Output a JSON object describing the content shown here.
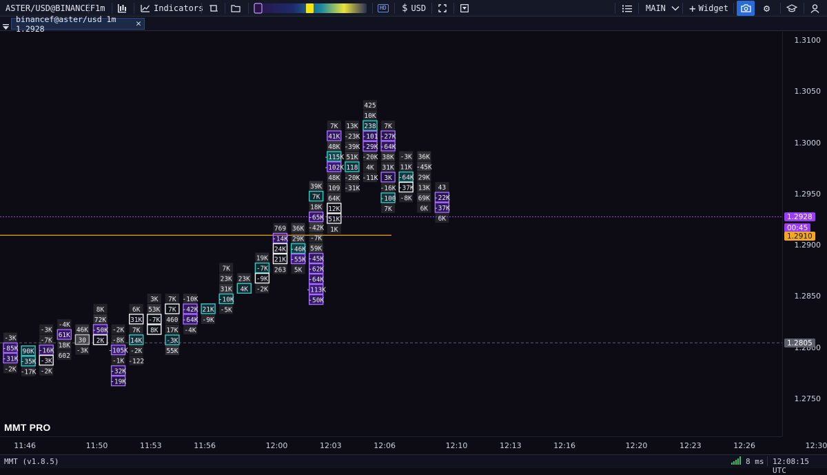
{
  "toolbar": {
    "symbol": "ASTER/USD@BINANCEF",
    "interval": "1m",
    "indicators_label": "Indicators",
    "hd_label": "HD",
    "currency_label": "USD",
    "layout_label": "MAIN",
    "widget_label": "Widget"
  },
  "tab": {
    "label": "binancef@aster/usd 1m 1.2928"
  },
  "chart": {
    "watermark": "MMT PRO",
    "y_ticks": [
      "1.3100",
      "1.3050",
      "1.3000",
      "1.2950",
      "1.2900",
      "1.2850",
      "1.2800",
      "1.2750"
    ],
    "x_ticks": [
      "11:46",
      "11:50",
      "11:53",
      "11:56",
      "12:00",
      "12:03",
      "12:06",
      "12:10",
      "12:13",
      "12:16",
      "12:20",
      "12:23",
      "12:26",
      "12:30"
    ],
    "price_tags": {
      "last_price": "1.2928",
      "countdown": "00:45",
      "orange_level": "1.2910",
      "grey_level": "1.2805"
    },
    "colors": {
      "background": "#0d0c14",
      "last_price": "#9a3df5",
      "orange_level": "#f0a825",
      "grey_level": "#5c5f6b",
      "teal": "#37c8c0"
    },
    "columns": [
      {
        "time": "11:45",
        "cells": [
          [
            "-3K",
            0.35,
            "d"
          ],
          [
            "-85K",
            0.6,
            "p"
          ],
          [
            "-31K",
            0.5,
            "p"
          ],
          [
            "-2K",
            0.3,
            "d"
          ]
        ]
      },
      {
        "time": "11:46",
        "cells": [
          [
            "90K",
            0.5,
            "t"
          ],
          [
            "-35K",
            0.55,
            "t"
          ],
          [
            "-17K",
            0.3,
            "d"
          ]
        ]
      },
      {
        "time": "11:47",
        "cells": [
          [
            "-3K",
            0.3,
            "d"
          ],
          [
            "-7K",
            0.35,
            "d"
          ],
          [
            "-16K",
            0.5,
            "p"
          ],
          [
            "-3K",
            0.4,
            "w"
          ],
          [
            "-2K",
            0.3,
            "d"
          ]
        ]
      },
      {
        "time": "11:48",
        "cells": [
          [
            "-4K",
            0.3,
            "d"
          ],
          [
            "61K",
            0.6,
            "p"
          ],
          [
            "18K",
            0.4,
            "d"
          ],
          [
            "602",
            0.3,
            "d"
          ]
        ]
      },
      {
        "time": "11:49",
        "cells": [
          [
            "46K",
            0.5,
            "d"
          ],
          [
            "30",
            0.6,
            "g"
          ],
          [
            "-3K",
            0.3,
            "d"
          ]
        ]
      },
      {
        "time": "11:50",
        "cells": [
          [
            "8K",
            0.3,
            "d"
          ],
          [
            "72K",
            0.5,
            "d"
          ],
          [
            "-50K",
            0.6,
            "p"
          ],
          [
            "2K",
            0.5,
            "w"
          ]
        ]
      },
      {
        "time": "11:51",
        "cells": [
          [
            "-2K",
            0.3,
            "d"
          ],
          [
            "-8K",
            0.35,
            "d"
          ],
          [
            "-105K",
            0.7,
            "p"
          ],
          [
            "-1K",
            0.3,
            "d"
          ],
          [
            "-32K",
            0.45,
            "p"
          ],
          [
            "-19K",
            0.35,
            "p"
          ]
        ]
      },
      {
        "time": "11:52",
        "cells": [
          [
            "6K",
            0.3,
            "d"
          ],
          [
            "31K",
            0.5,
            "w"
          ],
          [
            "7K",
            0.35,
            "d"
          ],
          [
            "14K",
            0.45,
            "t"
          ],
          [
            "-2K",
            0.3,
            "d"
          ],
          [
            "-122",
            0.3,
            "d"
          ]
        ]
      },
      {
        "time": "11:53",
        "cells": [
          [
            "3K",
            0.3,
            "d"
          ],
          [
            "53K",
            0.5,
            "d"
          ],
          [
            "-7K",
            0.35,
            "w"
          ],
          [
            "8K",
            0.35,
            "w"
          ]
        ]
      },
      {
        "time": "11:54",
        "cells": [
          [
            "7K",
            0.3,
            "d"
          ],
          [
            "7K",
            0.35,
            "w"
          ],
          [
            "460",
            0.3,
            "d"
          ],
          [
            "17K",
            0.35,
            "d"
          ],
          [
            "-3K",
            0.35,
            "t"
          ],
          [
            "55K",
            0.5,
            "d"
          ]
        ]
      },
      {
        "time": "11:55",
        "cells": [
          [
            "-10K",
            0.35,
            "d"
          ],
          [
            "-42K",
            0.55,
            "p"
          ],
          [
            "-64K",
            0.6,
            "p"
          ],
          [
            "-4K",
            0.3,
            "d"
          ]
        ]
      },
      {
        "time": "11:56",
        "cells": [
          [
            "21K",
            0.45,
            "t"
          ],
          [
            "-9K",
            0.35,
            "d"
          ]
        ]
      },
      {
        "time": "11:57",
        "cells": [
          [
            "7K",
            0.3,
            "d"
          ],
          [
            "23K",
            0.4,
            "d"
          ],
          [
            "31K",
            0.5,
            "d"
          ],
          [
            "-10K",
            0.4,
            "t"
          ],
          [
            "-5K",
            0.3,
            "d"
          ]
        ]
      },
      {
        "time": "11:58",
        "cells": [
          [
            "23K",
            0.4,
            "d"
          ],
          [
            "4K",
            0.35,
            "t"
          ]
        ]
      },
      {
        "time": "11:59",
        "cells": [
          [
            "19K",
            0.35,
            "d"
          ],
          [
            "-7K",
            0.35,
            "t"
          ],
          [
            "-9K",
            0.4,
            "w"
          ],
          [
            "-2K",
            0.3,
            "d"
          ]
        ]
      },
      {
        "time": "12:00",
        "cells": [
          [
            "769",
            0.3,
            "d"
          ],
          [
            "-14K",
            0.5,
            "p"
          ],
          [
            "24K",
            0.5,
            "w"
          ],
          [
            "21K",
            0.5,
            "w"
          ],
          [
            "263",
            0.3,
            "d"
          ]
        ]
      },
      {
        "time": "12:01",
        "cells": [
          [
            "36K",
            0.5,
            "d"
          ],
          [
            "29K",
            0.45,
            "d"
          ],
          [
            "-46K",
            0.6,
            "t"
          ],
          [
            "-55K",
            0.7,
            "p"
          ],
          [
            "5K",
            0.3,
            "d"
          ]
        ]
      },
      {
        "time": "12:02",
        "cells": [
          [
            "39K",
            0.5,
            "d"
          ],
          [
            "7K",
            0.35,
            "t"
          ],
          [
            "18K",
            0.4,
            "d"
          ],
          [
            "-65K",
            0.6,
            "p"
          ],
          [
            "-42K",
            0.55,
            "d"
          ],
          [
            "-7K",
            0.35,
            "d"
          ],
          [
            "59K",
            0.5,
            "d"
          ],
          [
            "-45K",
            0.55,
            "p"
          ],
          [
            "-62K",
            0.6,
            "p"
          ],
          [
            "-64K",
            0.6,
            "p"
          ],
          [
            "-113K",
            0.75,
            "p"
          ],
          [
            "-50K",
            0.55,
            "p"
          ]
        ]
      },
      {
        "time": "12:03",
        "cells": [
          [
            "7K",
            0.3,
            "d"
          ],
          [
            "41K",
            0.55,
            "p"
          ],
          [
            "48K",
            0.55,
            "d"
          ],
          [
            "-115K",
            0.75,
            "t"
          ],
          [
            "-102K",
            0.7,
            "p"
          ],
          [
            "48K",
            0.5,
            "d"
          ],
          [
            "109",
            0.45,
            "d"
          ],
          [
            "64K",
            0.5,
            "d"
          ],
          [
            "12K",
            0.4,
            "w"
          ],
          [
            "51K",
            0.5,
            "w"
          ],
          [
            "1K",
            0.3,
            "d"
          ]
        ]
      },
      {
        "time": "12:04",
        "cells": [
          [
            "13K",
            0.35,
            "d"
          ],
          [
            "-23K",
            0.4,
            "d"
          ],
          [
            "-39K",
            0.45,
            "d"
          ],
          [
            "51K",
            0.5,
            "d"
          ],
          [
            "118",
            0.5,
            "t"
          ],
          [
            "-20K",
            0.4,
            "d"
          ],
          [
            "-31K",
            0.4,
            "d"
          ]
        ]
      },
      {
        "time": "12:05",
        "cells": [
          [
            "425",
            0.3,
            "d"
          ],
          [
            "10K",
            0.35,
            "d"
          ],
          [
            "238",
            0.5,
            "t"
          ],
          [
            "-101",
            0.5,
            "p"
          ],
          [
            "-29K",
            0.45,
            "p"
          ],
          [
            "-20K",
            0.4,
            "d"
          ],
          [
            "4K",
            0.3,
            "d"
          ],
          [
            "-11K",
            0.35,
            "d"
          ]
        ]
      },
      {
        "time": "12:06",
        "cells": [
          [
            "7K",
            0.3,
            "d"
          ],
          [
            "-27K",
            0.45,
            "p"
          ],
          [
            "-64K",
            0.55,
            "p"
          ],
          [
            "38K",
            0.45,
            "d"
          ],
          [
            "31K",
            0.4,
            "d"
          ],
          [
            "3K",
            0.3,
            "p"
          ],
          [
            "-16K",
            0.35,
            "d"
          ],
          [
            "-100",
            0.5,
            "t"
          ],
          [
            "7K",
            0.3,
            "d"
          ]
        ]
      },
      {
        "time": "12:07",
        "cells": [
          [
            "-3K",
            0.35,
            "d"
          ],
          [
            "11K",
            0.35,
            "d"
          ],
          [
            "-64K",
            0.55,
            "t"
          ],
          [
            "-37K",
            0.45,
            "w"
          ],
          [
            "-8K",
            0.3,
            "d"
          ]
        ]
      },
      {
        "time": "12:08",
        "cells": [
          [
            "36K",
            0.45,
            "d"
          ],
          [
            "-45K",
            0.5,
            "d"
          ],
          [
            "29K",
            0.4,
            "d"
          ],
          [
            "13K",
            0.45,
            "d"
          ],
          [
            "69K",
            0.5,
            "d"
          ],
          [
            "6K",
            0.3,
            "d"
          ]
        ]
      },
      {
        "time": "12:09",
        "cells": [
          [
            "43",
            0.3,
            "d"
          ],
          [
            "-22K",
            0.45,
            "p"
          ],
          [
            "-37K",
            0.5,
            "p"
          ],
          [
            "6K",
            0.3,
            "d"
          ]
        ]
      }
    ]
  },
  "statusbar": {
    "version": "MMT (v1.8.5)",
    "latency": "8 ms",
    "clock": "12:08:15 UTC"
  }
}
